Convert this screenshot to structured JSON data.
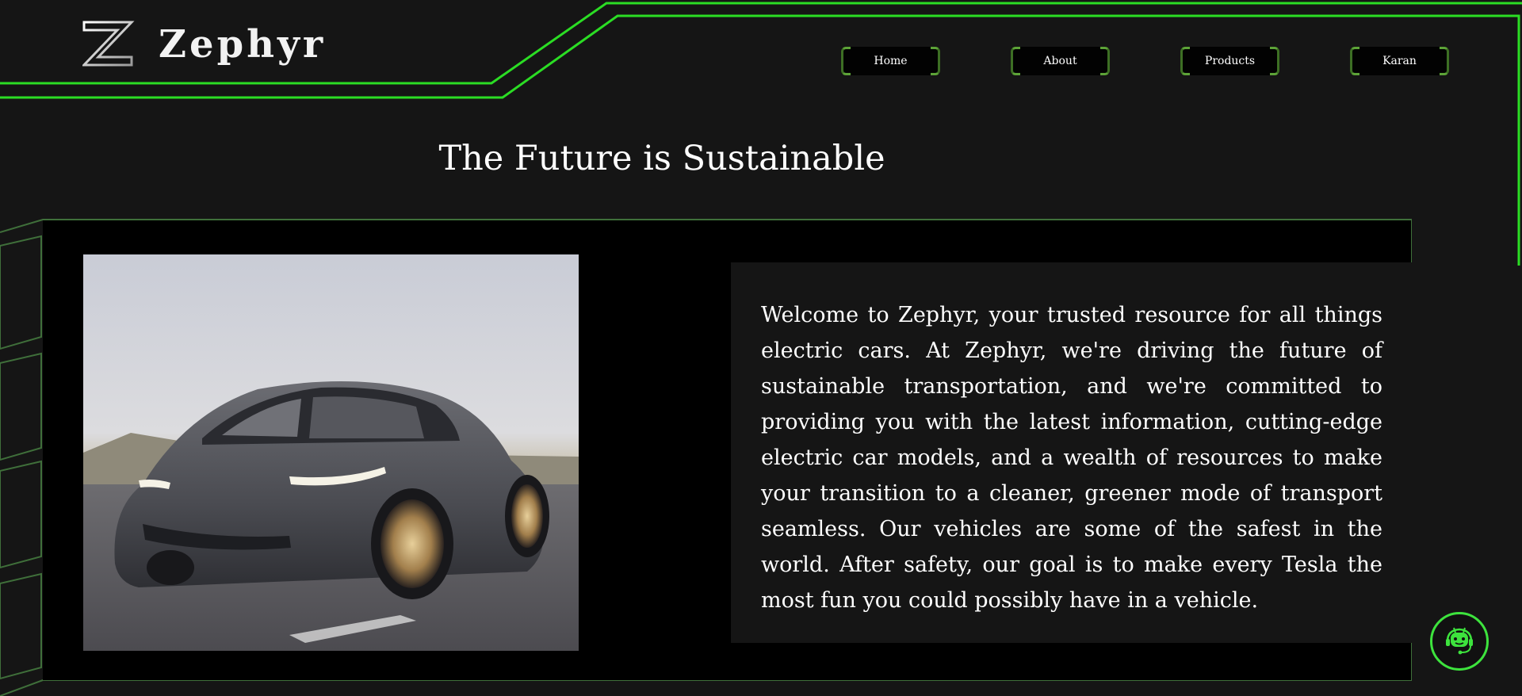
{
  "brand": {
    "name": "Zephyr",
    "logo_icon": "zephyr-z-logo"
  },
  "nav": {
    "items": [
      {
        "label": "Home"
      },
      {
        "label": "About"
      },
      {
        "label": "Products"
      },
      {
        "label": "Karan"
      }
    ]
  },
  "hero": {
    "title": "The Future is Sustainable",
    "image_alt_icon": "electric-car-photo",
    "intro": "Welcome to Zephyr, your trusted resource for all things electric cars. At Zephyr, we're driving the future of sustainable transportation, and we're committed to providing you with the latest information, cutting-edge electric car models, and a wealth of resources to make your transition to a cleaner, greener mode of transport seamless. Our vehicles are some of the safest in the world. After safety, our goal is to make every Tesla the most fun you could possibly have in a vehicle."
  },
  "chatbot": {
    "icon": "robot-headset-icon"
  },
  "colors": {
    "accent": "#2bdd24",
    "frame_line": "#3f6f3a",
    "background": "#151515",
    "panel": "#000000"
  }
}
